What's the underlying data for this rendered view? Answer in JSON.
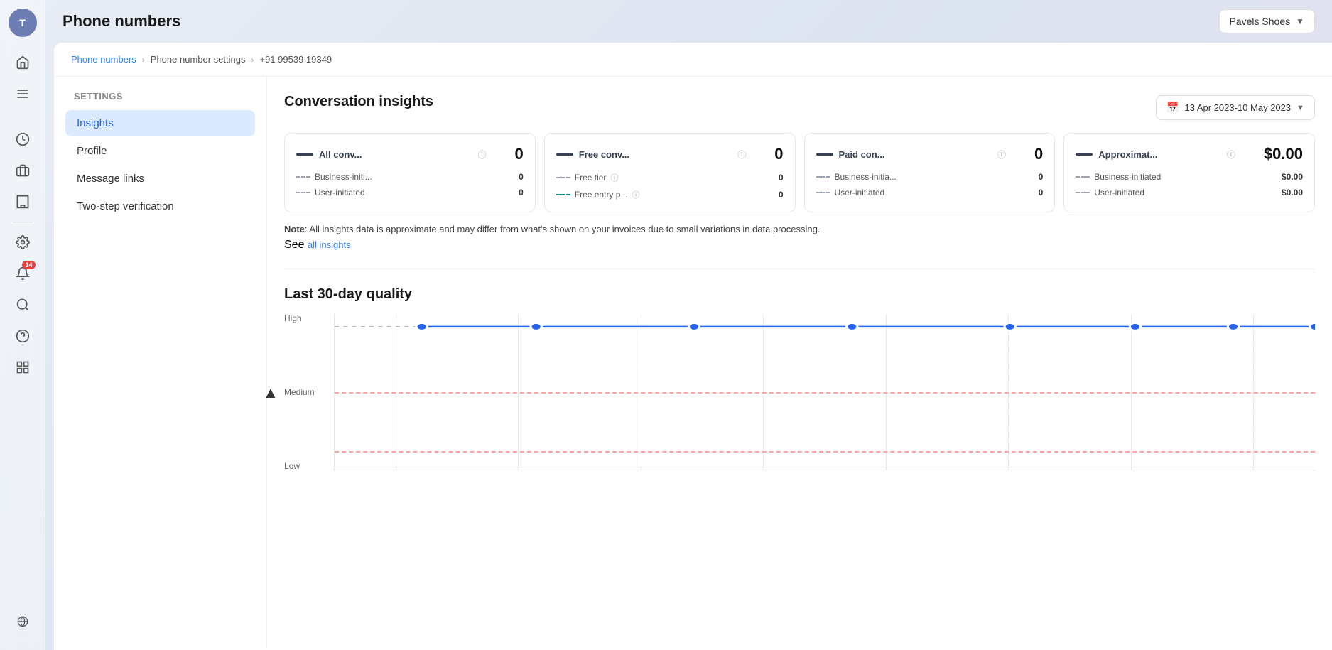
{
  "app": {
    "workspace": "Pavels Shoes",
    "page_title": "Phone numbers"
  },
  "sidebar": {
    "avatar": "T",
    "notification_badge": "14",
    "icons": [
      {
        "name": "home-icon",
        "symbol": "⌂"
      },
      {
        "name": "menu-icon",
        "symbol": "☰"
      },
      {
        "name": "clock-icon",
        "symbol": "🕐"
      },
      {
        "name": "briefcase-icon",
        "symbol": "🗂"
      },
      {
        "name": "building-icon",
        "symbol": "🏛"
      },
      {
        "name": "settings-icon",
        "symbol": "⚙"
      },
      {
        "name": "bell-icon",
        "symbol": "🔔"
      },
      {
        "name": "search-icon",
        "symbol": "🔍"
      },
      {
        "name": "help-icon",
        "symbol": "?"
      },
      {
        "name": "grid-icon",
        "symbol": "⊞"
      }
    ]
  },
  "breadcrumb": {
    "items": [
      {
        "label": "Phone numbers",
        "link": true
      },
      {
        "label": "Phone number settings",
        "link": false
      },
      {
        "label": "+91 99539 19349",
        "link": false
      }
    ]
  },
  "settings_nav": {
    "title": "Settings",
    "items": [
      {
        "label": "Insights",
        "active": true
      },
      {
        "label": "Profile",
        "active": false
      },
      {
        "label": "Message links",
        "active": false
      },
      {
        "label": "Two-step verification",
        "active": false
      }
    ]
  },
  "conversation_insights": {
    "title": "Conversation insights",
    "date_range": "13 Apr 2023-10 May 2023",
    "metrics": [
      {
        "label": "All conv...",
        "value": "0",
        "sub_items": [
          {
            "line_style": "dashed",
            "label": "Business-initi...",
            "info": false,
            "value": "0"
          },
          {
            "line_style": "dashed",
            "label": "User-initiated",
            "info": false,
            "value": "0"
          }
        ]
      },
      {
        "label": "Free conv...",
        "value": "0",
        "sub_items": [
          {
            "line_style": "dashed",
            "label": "Free tier",
            "info": true,
            "value": "0"
          },
          {
            "line_style": "dashed-teal",
            "label": "Free entry p...",
            "info": true,
            "value": "0"
          }
        ]
      },
      {
        "label": "Paid con...",
        "value": "0",
        "sub_items": [
          {
            "line_style": "dashed",
            "label": "Business-initia...",
            "info": false,
            "value": "0"
          },
          {
            "line_style": "dashed",
            "label": "User-initiated",
            "info": false,
            "value": "0"
          }
        ]
      },
      {
        "label": "Approximat...",
        "value": "$0.00",
        "sub_items": [
          {
            "line_style": "dashed",
            "label": "Business-initiated",
            "info": false,
            "value": "$0.00"
          },
          {
            "line_style": "dashed",
            "label": "User-initiated",
            "info": false,
            "value": "$0.00"
          }
        ]
      }
    ],
    "note": "Note",
    "note_text": ": All insights data is approximate and may differ from what's shown on your invoices due to small variations in data processing.",
    "see_all_text": "See",
    "all_insights_link": "all insights"
  },
  "quality": {
    "title": "Last 30-day quality",
    "labels": {
      "high": "High",
      "medium": "Medium",
      "low": "Low"
    },
    "chart_points": [
      0,
      1,
      2,
      3,
      4,
      5,
      6,
      7,
      8
    ]
  }
}
